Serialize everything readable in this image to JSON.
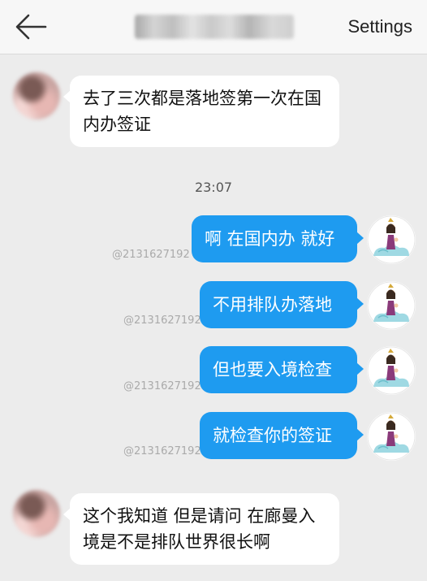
{
  "header": {
    "settings_label": "Settings",
    "back_icon": "arrow-left-icon"
  },
  "messages": [
    {
      "side": "in",
      "text": "去了三次都是落地签第一次在国内办签证"
    },
    {
      "side": "out",
      "text": "啊 在国内办 就好",
      "tag": "@2131627192"
    },
    {
      "side": "out",
      "text": "不用排队办落地",
      "tag": "@2131627192"
    },
    {
      "side": "out",
      "text": "但也要入境检查",
      "tag": "@2131627192"
    },
    {
      "side": "out",
      "text": "就检查你的签证",
      "tag": "@2131627192"
    },
    {
      "side": "in",
      "text": "这个我知道 但是请问 在廊曼入境是不是排队世界很长啊"
    }
  ],
  "timestamp": "23:07",
  "colors": {
    "outgoing_bubble": "#1e9bf0",
    "incoming_bubble": "#ffffff",
    "background": "#ececec"
  }
}
